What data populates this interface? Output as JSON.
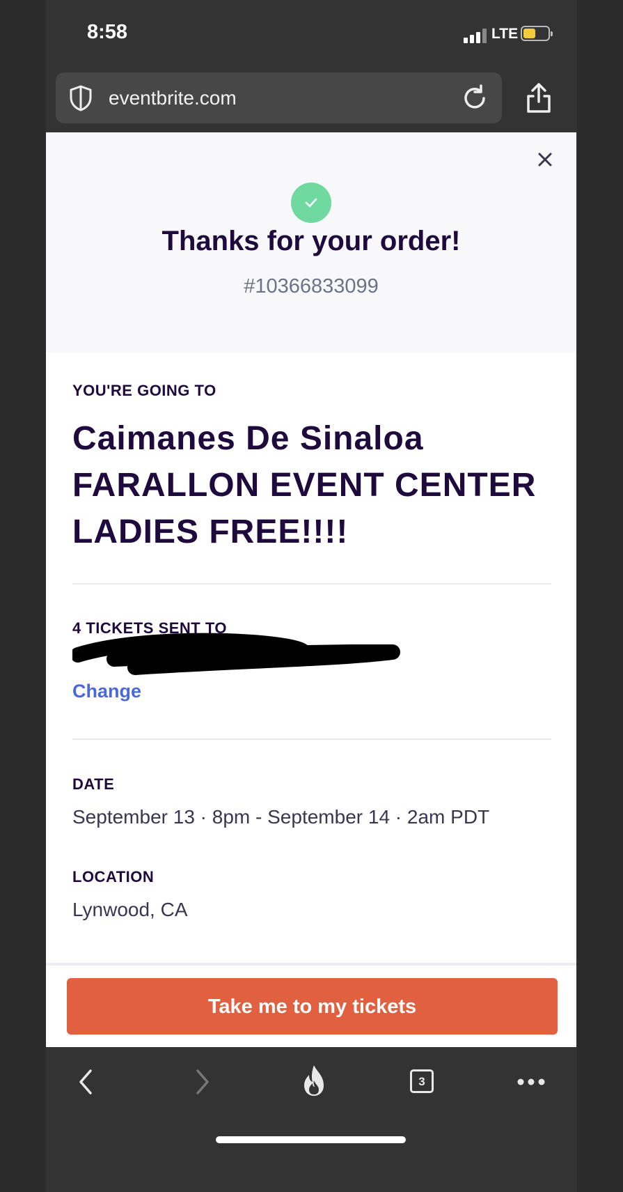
{
  "status_bar": {
    "time": "8:58",
    "network": "LTE"
  },
  "browser": {
    "url": "eventbrite.com",
    "open_tabs": "3"
  },
  "order_confirmation": {
    "heading": "Thanks for your order!",
    "order_number": "#10366833099",
    "going_label": "YOU'RE GOING TO",
    "event_title": "Caimanes De Sinaloa FARALLON EVENT CENTER LADIES FREE!!!!",
    "tickets_label": "4 TICKETS SENT TO",
    "change_label": "Change",
    "date_label": "DATE",
    "date_value": "September 13 · 8pm - September 14 · 2am PDT",
    "location_label": "LOCATION",
    "location_value": "Lynwood, CA",
    "cta_label": "Take me to my tickets"
  },
  "colors": {
    "success": "#6fd9a0",
    "cta": "#e0603f",
    "link": "#4a68d8",
    "heading": "#1e0a3c"
  }
}
